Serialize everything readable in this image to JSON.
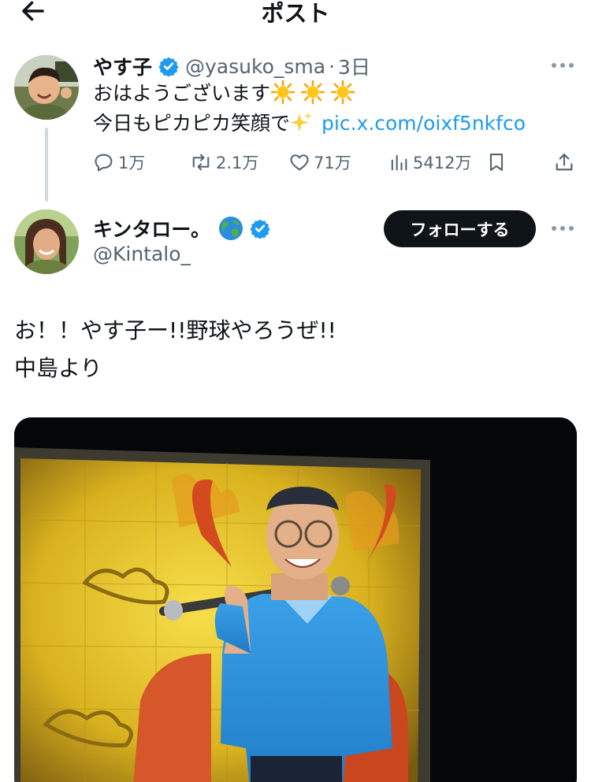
{
  "header": {
    "title": "ポスト",
    "back_icon": "arrow-left-icon"
  },
  "quoted_post": {
    "display_name": "やす子",
    "handle": "@yasuko_sma",
    "separator": "·",
    "time": "3日",
    "text_line1": "おはようございます",
    "text_line2": "今日もピカピカ笑顔で",
    "link": "pic.x.com/oixf5nkfco",
    "stats": {
      "replies": "1万",
      "reposts": "2.1万",
      "likes": "71万",
      "views": "5412万"
    }
  },
  "main_post": {
    "display_name": "キンタロー。",
    "handle": "@Kintalo_",
    "follow_label": "フォローする",
    "text_line1": "お！！やす子ー!!野球やろうぜ!!",
    "text_line2": "中島より"
  },
  "colors": {
    "text": "#0f1419",
    "secondary": "#536471",
    "link": "#1d9bf0",
    "verified": "#1d9bf0",
    "follow_button": "#0f1419"
  }
}
